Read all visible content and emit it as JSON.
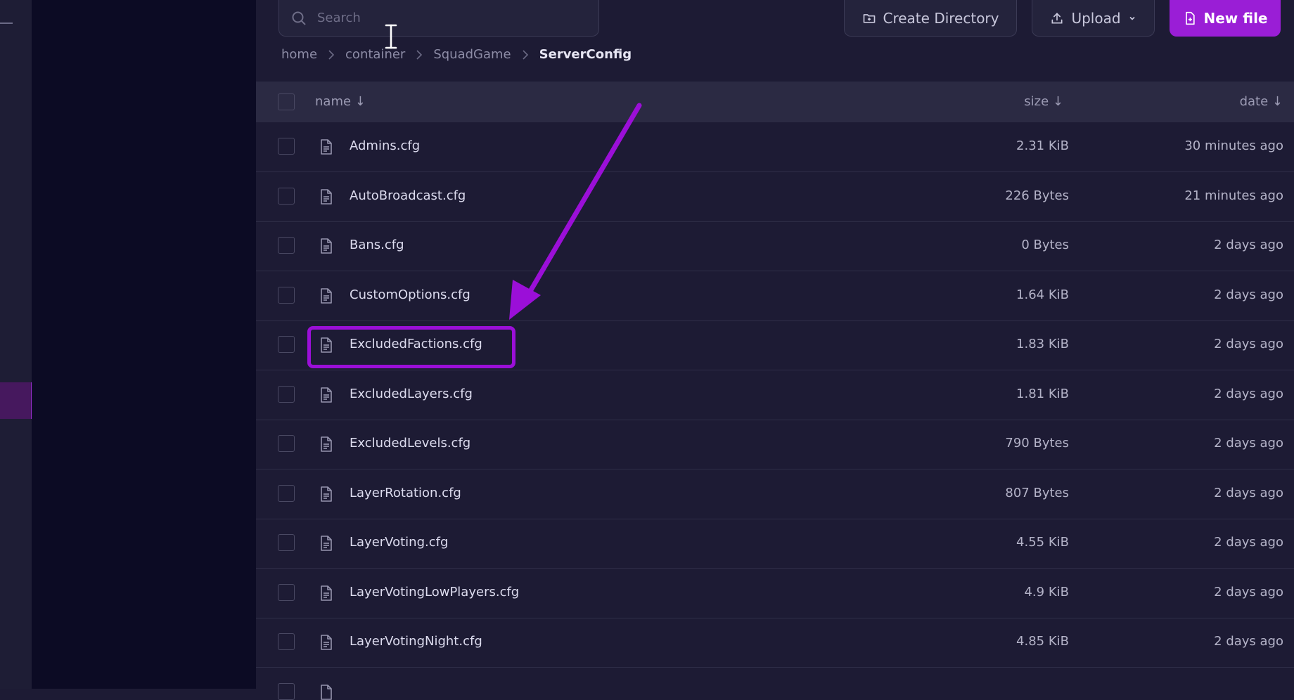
{
  "search": {
    "placeholder": "Search"
  },
  "toolbar": {
    "create_directory_label": "Create Directory",
    "upload_label": "Upload",
    "new_file_label": "New file"
  },
  "breadcrumb": {
    "items": [
      "home",
      "container",
      "SquadGame",
      "ServerConfig"
    ]
  },
  "table": {
    "headers": {
      "name": "name ↓",
      "size": "size ↓",
      "date": "date ↓"
    },
    "rows": [
      {
        "name": "Admins.cfg",
        "size": "2.31 KiB",
        "date": "30 minutes ago"
      },
      {
        "name": "AutoBroadcast.cfg",
        "size": "226 Bytes",
        "date": "21 minutes ago"
      },
      {
        "name": "Bans.cfg",
        "size": "0 Bytes",
        "date": "2 days ago"
      },
      {
        "name": "CustomOptions.cfg",
        "size": "1.64 KiB",
        "date": "2 days ago"
      },
      {
        "name": "ExcludedFactions.cfg",
        "size": "1.83 KiB",
        "date": "2 days ago"
      },
      {
        "name": "ExcludedLayers.cfg",
        "size": "1.81 KiB",
        "date": "2 days ago"
      },
      {
        "name": "ExcludedLevels.cfg",
        "size": "790 Bytes",
        "date": "2 days ago"
      },
      {
        "name": "LayerRotation.cfg",
        "size": "807 Bytes",
        "date": "2 days ago"
      },
      {
        "name": "LayerVoting.cfg",
        "size": "4.55 KiB",
        "date": "2 days ago"
      },
      {
        "name": "LayerVotingLowPlayers.cfg",
        "size": "4.9 KiB",
        "date": "2 days ago"
      },
      {
        "name": "LayerVotingNight.cfg",
        "size": "4.85 KiB",
        "date": "2 days ago"
      }
    ]
  },
  "colors": {
    "accent": "#9a1ed6",
    "annotation": "#9b0fd8",
    "sidebar": "#0c0b24",
    "main": "#1d1b34"
  },
  "icons": [
    "search-icon",
    "folder-plus-icon",
    "upload-icon",
    "chevron-down-icon",
    "file-plus-icon",
    "file-icon",
    "chevron-right-icon",
    "text-cursor-icon"
  ]
}
